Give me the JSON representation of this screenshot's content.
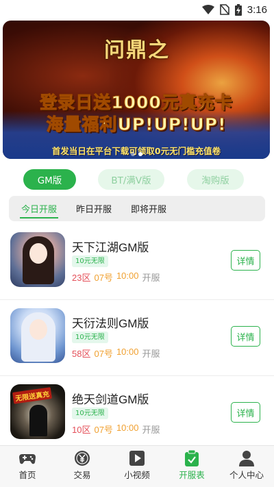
{
  "status_bar": {
    "time": "3:16"
  },
  "banner": {
    "logo_text": "问鼎之",
    "headline_line1": "登录日送1000元真充卡",
    "headline_line2": "海量福利UP!UP!UP!",
    "subline": "首发当日在平台下载可领取0元无门槛充值卷",
    "page_count": 2,
    "active_page": 1
  },
  "versions": {
    "gm_label": "GM版",
    "bt_label": "BT/满V版",
    "taogou_label": "淘购版",
    "active": "GM版"
  },
  "date_tabs": {
    "today": "今日开服",
    "yesterday": "昨日开服",
    "upcoming": "即将开服",
    "active": "今日开服"
  },
  "games": [
    {
      "name": "天下江湖GM版",
      "tag": "10元无限",
      "zone": "23区",
      "date": "07号",
      "time": "10:00",
      "status": "开服",
      "detail_label": "详情"
    },
    {
      "name": "天衍法则GM版",
      "tag": "10元无限",
      "zone": "58区",
      "date": "07号",
      "time": "10:00",
      "status": "开服",
      "detail_label": "详情"
    },
    {
      "name": "绝天剑道GM版",
      "tag": "10元无限",
      "zone": "10区",
      "date": "07号",
      "time": "10:00",
      "status": "开服",
      "detail_label": "详情",
      "icon_badge": "无限送真充"
    }
  ],
  "bottom_nav": {
    "home": "首页",
    "trade": "交易",
    "video": "小视频",
    "schedule": "开服表",
    "profile": "个人中心",
    "active": "开服表"
  },
  "colors": {
    "accent": "#2bb24c",
    "zone": "#e4505a",
    "date": "#f0a030"
  }
}
